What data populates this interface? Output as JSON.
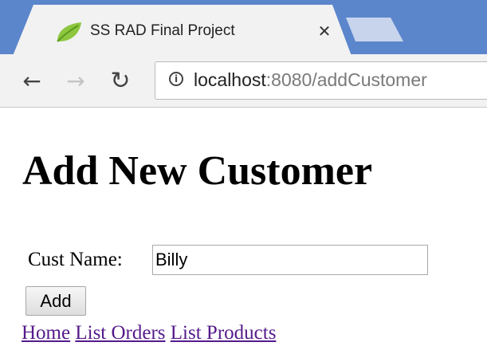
{
  "browser": {
    "tab": {
      "title": "SS RAD Final Project",
      "close_glyph": "✕",
      "favicon": "spring-leaf-icon"
    },
    "toolbar": {
      "back_icon": "back-arrow-icon",
      "forward_icon": "forward-arrow-icon",
      "reload_icon": "reload-icon"
    },
    "address_bar": {
      "info_icon": "info-icon",
      "url_host": "localhost",
      "url_rest": ":8080/addCustomer"
    },
    "colors": {
      "tabstrip": "#5c86cc",
      "chrome": "#f2f2f2"
    }
  },
  "page": {
    "title": "Add New Customer",
    "form": {
      "name_label": "Cust Name:",
      "name_value": "Billy",
      "submit_label": "Add"
    },
    "links": [
      {
        "label": "Home"
      },
      {
        "label": "List Orders"
      },
      {
        "label": "List Products"
      }
    ],
    "colors": {
      "visited_link": "#551a8b"
    }
  }
}
